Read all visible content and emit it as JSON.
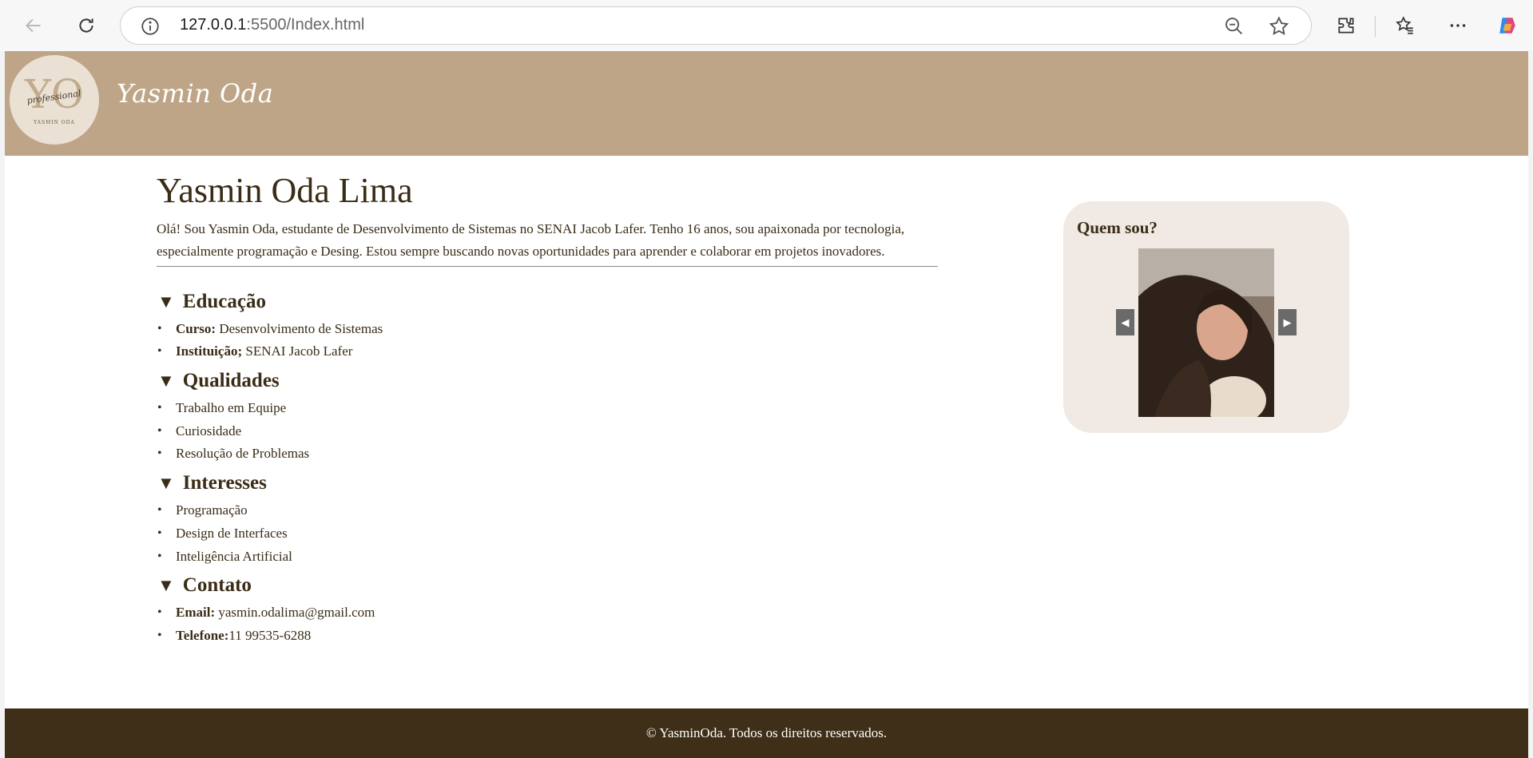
{
  "browser": {
    "url_host": "127.0.0.1",
    "url_rest": ":5500/Index.html"
  },
  "header": {
    "logo_initials": "YO",
    "logo_script": "professional",
    "logo_caption": "YASMIN ODA",
    "brand": "Yasmin Oda"
  },
  "main": {
    "name": "Yasmin Oda Lima",
    "intro": "Olá! Sou Yasmin Oda, estudante de Desenvolvimento de Sistemas no SENAI Jacob Lafer. Tenho 16 anos, sou apaixonada por tecnologia, especialmente programação e Desing. Estou sempre buscando novas oportunidades para aprender e colaborar em projetos inovadores.",
    "sections": [
      {
        "marker": "▼",
        "title": "Educação",
        "items": [
          {
            "label": "Curso:",
            "value": " Desenvolvimento de Sistemas"
          },
          {
            "label": "Instituição;",
            "value": " SENAI Jacob Lafer"
          }
        ]
      },
      {
        "marker": "▼",
        "title": "Qualidades",
        "items": [
          {
            "label": "",
            "value": "Trabalho em Equipe"
          },
          {
            "label": "",
            "value": "Curiosidade"
          },
          {
            "label": "",
            "value": "Resolução de Problemas"
          }
        ]
      },
      {
        "marker": "▼",
        "title": "Interesses",
        "items": [
          {
            "label": "",
            "value": "Programação"
          },
          {
            "label": "",
            "value": "Design de Interfaces"
          },
          {
            "label": "",
            "value": "Inteligência Artificial"
          }
        ]
      },
      {
        "marker": "▼",
        "title": "Contato",
        "items": [
          {
            "label": "Email:",
            "value": " yasmin.odalima@gmail.com"
          },
          {
            "label": "Telefone:",
            "value": "11 99535-6288"
          }
        ]
      }
    ]
  },
  "sidebar": {
    "title": "Quem sou?",
    "prev_glyph": "◀",
    "next_glyph": "▶"
  },
  "footer": {
    "text": "© YasminOda. Todos os direitos reservados."
  },
  "colors": {
    "header_bg": "#bfa588",
    "footer_bg": "#3f2f18",
    "text_brown": "#3a2c17",
    "card_bg": "#f1e9e3"
  }
}
